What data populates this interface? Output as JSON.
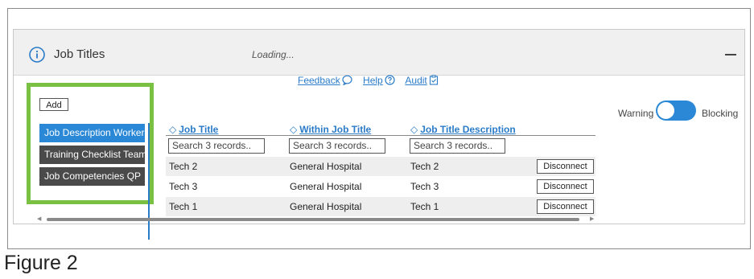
{
  "panel": {
    "title": "Job Titles",
    "status": "Loading..."
  },
  "links": {
    "feedback": "Feedback",
    "help": "Help",
    "audit": "Audit"
  },
  "sidebar": {
    "add_label": "Add",
    "items": [
      {
        "label": "Job Description Worker",
        "active": true
      },
      {
        "label": "Training Checklist Team",
        "active": false
      },
      {
        "label": "Job Competencies QP",
        "active": false
      }
    ]
  },
  "table": {
    "columns": [
      "Job Title",
      "Within Job Title",
      "Job Title Description"
    ],
    "search_placeholder": "Search 3 records..",
    "rows": [
      {
        "job_title": "Tech 2",
        "within": "General Hospital",
        "description": "Tech 2",
        "action": "Disconnect"
      },
      {
        "job_title": "Tech 3",
        "within": "General Hospital",
        "description": "Tech 3",
        "action": "Disconnect"
      },
      {
        "job_title": "Tech 1",
        "within": "General Hospital",
        "description": "Tech 1",
        "action": "Disconnect"
      }
    ]
  },
  "toggle": {
    "left_label": "Warning",
    "right_label": "Blocking",
    "accent": "#2a88d6"
  },
  "caption": "Figure 2",
  "colors": {
    "link": "#2a7bc8",
    "highlight_border": "#7ac143",
    "dark_item": "#4a4a4a"
  },
  "icons": {
    "info": "info-circle-icon",
    "collapse": "minus-icon",
    "feedback": "speech-bubble-icon",
    "help": "question-circle-icon",
    "audit": "clipboard-check-icon",
    "sort": "sort-arrows-icon"
  }
}
